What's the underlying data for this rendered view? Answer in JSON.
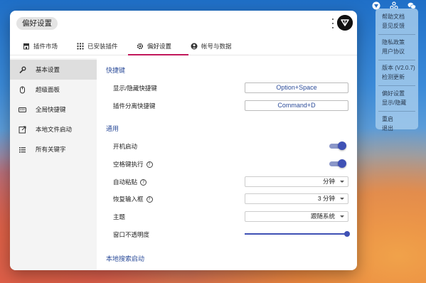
{
  "menubar": {
    "icons": [
      "utools-icon",
      "share-icon",
      "wechat-icon"
    ]
  },
  "tray_menu": {
    "groups": [
      [
        "帮助文档",
        "意见反馈"
      ],
      [
        "隐私政策",
        "用户协议"
      ],
      [
        "版本 (V2.0.7)",
        "检测更新"
      ],
      [
        "偏好设置",
        "显示/隐藏"
      ],
      [
        "重启",
        "退出"
      ]
    ]
  },
  "window": {
    "title": "偏好设置",
    "tabs": [
      {
        "label": "插件市场",
        "icon": "store-icon"
      },
      {
        "label": "已安装插件",
        "icon": "apps-grid-icon"
      },
      {
        "label": "偏好设置",
        "icon": "gear-icon",
        "active": true
      },
      {
        "label": "帐号与数据",
        "icon": "account-icon"
      }
    ],
    "sidebar": [
      {
        "label": "基本设置",
        "icon": "wrench-icon",
        "active": true
      },
      {
        "label": "超级面板",
        "icon": "mouse-icon"
      },
      {
        "label": "全局快捷键",
        "icon": "keyboard-icon"
      },
      {
        "label": "本地文件启动",
        "icon": "launch-icon"
      },
      {
        "label": "所有关键字",
        "icon": "list-icon"
      }
    ],
    "settings": {
      "shortcut_section": "快捷键",
      "show_hide_label": "显示/隐藏快捷键",
      "show_hide_value": "Option+Space",
      "detach_label": "插件分离快捷键",
      "detach_value": "Command+D",
      "general_section": "通用",
      "autostart_label": "开机启动",
      "autostart_on": true,
      "space_exec_label": "空格键执行",
      "space_exec_on": true,
      "autopaste_label": "自动粘贴",
      "autopaste_value": "分钟",
      "restore_label": "恢复输入框",
      "restore_value": "3 分钟",
      "theme_label": "主题",
      "theme_value": "跟随系统",
      "opacity_label": "窗口不透明度",
      "opacity_fraction": 1.0,
      "local_search_section": "本地搜索启动"
    },
    "colors": {
      "accent": "#3f51b5",
      "tab_underline": "#c2185b",
      "section_title": "#2d4d9a"
    }
  }
}
